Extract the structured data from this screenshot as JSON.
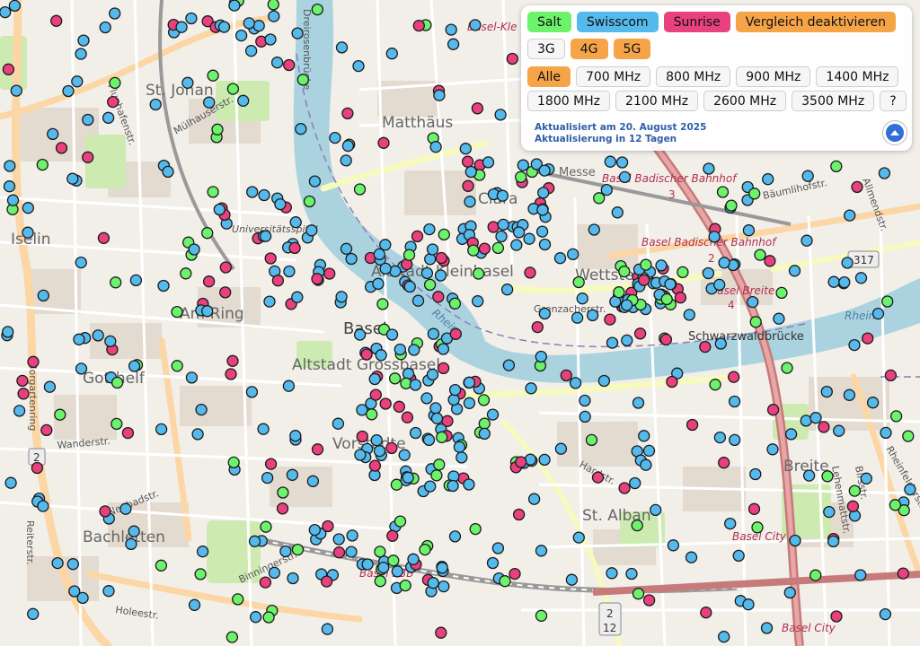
{
  "colors": {
    "salt": "#6cf26b",
    "swisscom": "#55b9ec",
    "sunrise": "#e8417e",
    "compare": "#f6a448",
    "river": "#aad3df",
    "rail": "#c77a7a"
  },
  "map_labels": {
    "basel_klein": "Basel-Kle",
    "st_johann": "St. Johan",
    "matthaeus": "Matthäus",
    "clara": "Clara",
    "messe": "Messe",
    "badischer_bahnhof_1": "Basel Badischer Bahnhof",
    "badischer_bahnhof_num_1": "3",
    "badischer_bahnhof_2": "Basel Badischer Bahnhof",
    "badischer_bahnhof_num_2": "2",
    "baumlihof": "Bäumlihofstr.",
    "allmend": "Allmendstr.",
    "iselin": "Iselin",
    "universitaetsspital": "Universitätsspital",
    "altstadt_kleinbasel": "Altstadt Kleinbasel",
    "wettstein": "Wettstein",
    "basel_breite": "Basel Breite",
    "basel_breite_num": "4",
    "road_317": "317",
    "am_ring": "Am Ring",
    "basel": "Basel",
    "grenzacher": "Grenzacherstr.",
    "rhein_1": "Rhein",
    "rhein_2": "Rhein",
    "schwarzwaldbruecke": "Schwarzwaldbrücke",
    "gotthelf": "Gotthelf",
    "altstadt_grossbasel": "Altstadt Grossbasel",
    "vorstadt": "Vorstädte",
    "morgartenring": "Morgartenring",
    "wanderstr": "Wanderstr.",
    "neubadstr": "Neubadstr.",
    "hardstr": "Hardstr.",
    "breite": "Breite",
    "birsstr": "Birsstr.",
    "st_alban": "St. Alban",
    "basel_city_1": "Basel City",
    "basel_city_2": "Basel City",
    "bachletten": "Bachletten",
    "binningerstr": "Binningerstr.",
    "basel_sbb": "Basel SBB",
    "holeestr": "Holeestr.",
    "route_2a": "2",
    "route_2b": "2",
    "route_12": "12",
    "flughafenstr": "Flughafenstr.",
    "muelhauserstr": "Mülhauserstr.",
    "dreirosen": "Dreirosenbrücke",
    "rheinfelderstr": "Rheinfelderstr.",
    "lehenmattstr": "Lehenmattstr.",
    "reiterstr": "Reiterstr."
  },
  "operators": [
    {
      "label": "Salt",
      "color": "#6cf26b"
    },
    {
      "label": "Swisscom",
      "color": "#55b9ec"
    },
    {
      "label": "Sunrise",
      "color": "#e8417e"
    },
    {
      "label": "Vergleich deaktivieren",
      "color": "#f6a448"
    }
  ],
  "technologies": [
    {
      "label": "3G",
      "active": false
    },
    {
      "label": "4G",
      "active": true
    },
    {
      "label": "5G",
      "active": true
    }
  ],
  "frequencies": [
    {
      "label": "Alle",
      "active": true
    },
    {
      "label": "700 MHz",
      "active": false
    },
    {
      "label": "800 MHz",
      "active": false
    },
    {
      "label": "900 MHz",
      "active": false
    },
    {
      "label": "1400 MHz",
      "active": false
    },
    {
      "label": "1800 MHz",
      "active": false
    },
    {
      "label": "2100 MHz",
      "active": false
    },
    {
      "label": "2600 MHz",
      "active": false
    },
    {
      "label": "3500 MHz",
      "active": false
    },
    {
      "label": "?",
      "active": false
    }
  ],
  "info": {
    "updated": "Aktualisiert am 20. August 2025",
    "next_update": "Aktualisierung in 12 Tagen"
  },
  "up_button_icon": "chevron-up-icon"
}
